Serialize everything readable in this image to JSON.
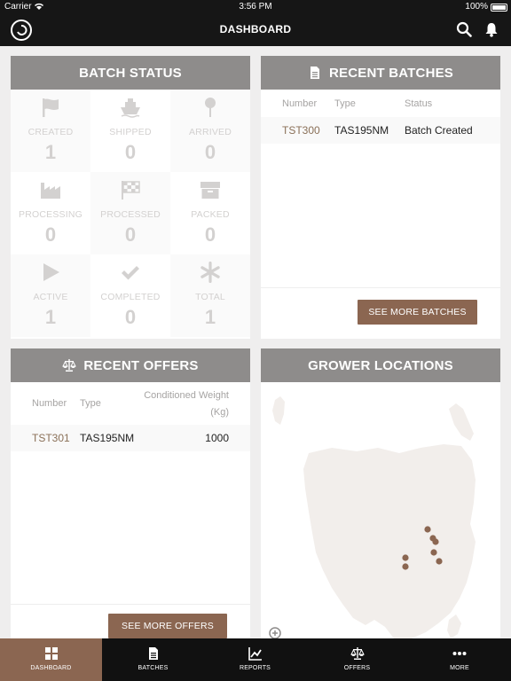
{
  "status_bar": {
    "carrier": "Carrier",
    "time": "3:56 PM",
    "battery": "100%"
  },
  "header": {
    "title": "DASHBOARD"
  },
  "batch_status": {
    "title": "BATCH STATUS",
    "items": [
      {
        "label": "CREATED",
        "count": "1",
        "icon": "flag-icon"
      },
      {
        "label": "SHIPPED",
        "count": "0",
        "icon": "ship-icon"
      },
      {
        "label": "ARRIVED",
        "count": "0",
        "icon": "pin-icon"
      },
      {
        "label": "PROCESSING",
        "count": "0",
        "icon": "factory-icon"
      },
      {
        "label": "PROCESSED",
        "count": "0",
        "icon": "checkered-flag-icon"
      },
      {
        "label": "PACKED",
        "count": "0",
        "icon": "box-icon"
      },
      {
        "label": "ACTIVE",
        "count": "1",
        "icon": "play-icon"
      },
      {
        "label": "COMPLETED",
        "count": "0",
        "icon": "check-icon"
      },
      {
        "label": "TOTAL",
        "count": "1",
        "icon": "asterisk-icon"
      }
    ]
  },
  "recent_batches": {
    "title": "RECENT BATCHES",
    "columns": [
      "Number",
      "Type",
      "Status"
    ],
    "rows": [
      {
        "number": "TST300",
        "type": "TAS195NM",
        "status": "Batch Created"
      }
    ],
    "button": "SEE MORE BATCHES"
  },
  "recent_offers": {
    "title": "RECENT OFFERS",
    "columns": [
      "Number",
      "Type",
      "Conditioned Weight",
      "(Kg)"
    ],
    "rows": [
      {
        "number": "TST301",
        "type": "TAS195NM",
        "weight": "1000"
      }
    ],
    "button": "SEE MORE OFFERS"
  },
  "grower_locations": {
    "title": "GROWER LOCATIONS"
  },
  "tabs": [
    {
      "label": "DASHBOARD",
      "icon": "grid-icon",
      "active": true
    },
    {
      "label": "BATCHES",
      "icon": "document-icon",
      "active": false
    },
    {
      "label": "REPORTS",
      "icon": "chart-icon",
      "active": false
    },
    {
      "label": "OFFERS",
      "icon": "scales-icon",
      "active": false
    },
    {
      "label": "MORE",
      "icon": "more-icon",
      "active": false
    }
  ],
  "colors": {
    "accent": "#8b6651",
    "header": "#8e8c8b",
    "dark": "#161616",
    "link": "#8a7058"
  }
}
